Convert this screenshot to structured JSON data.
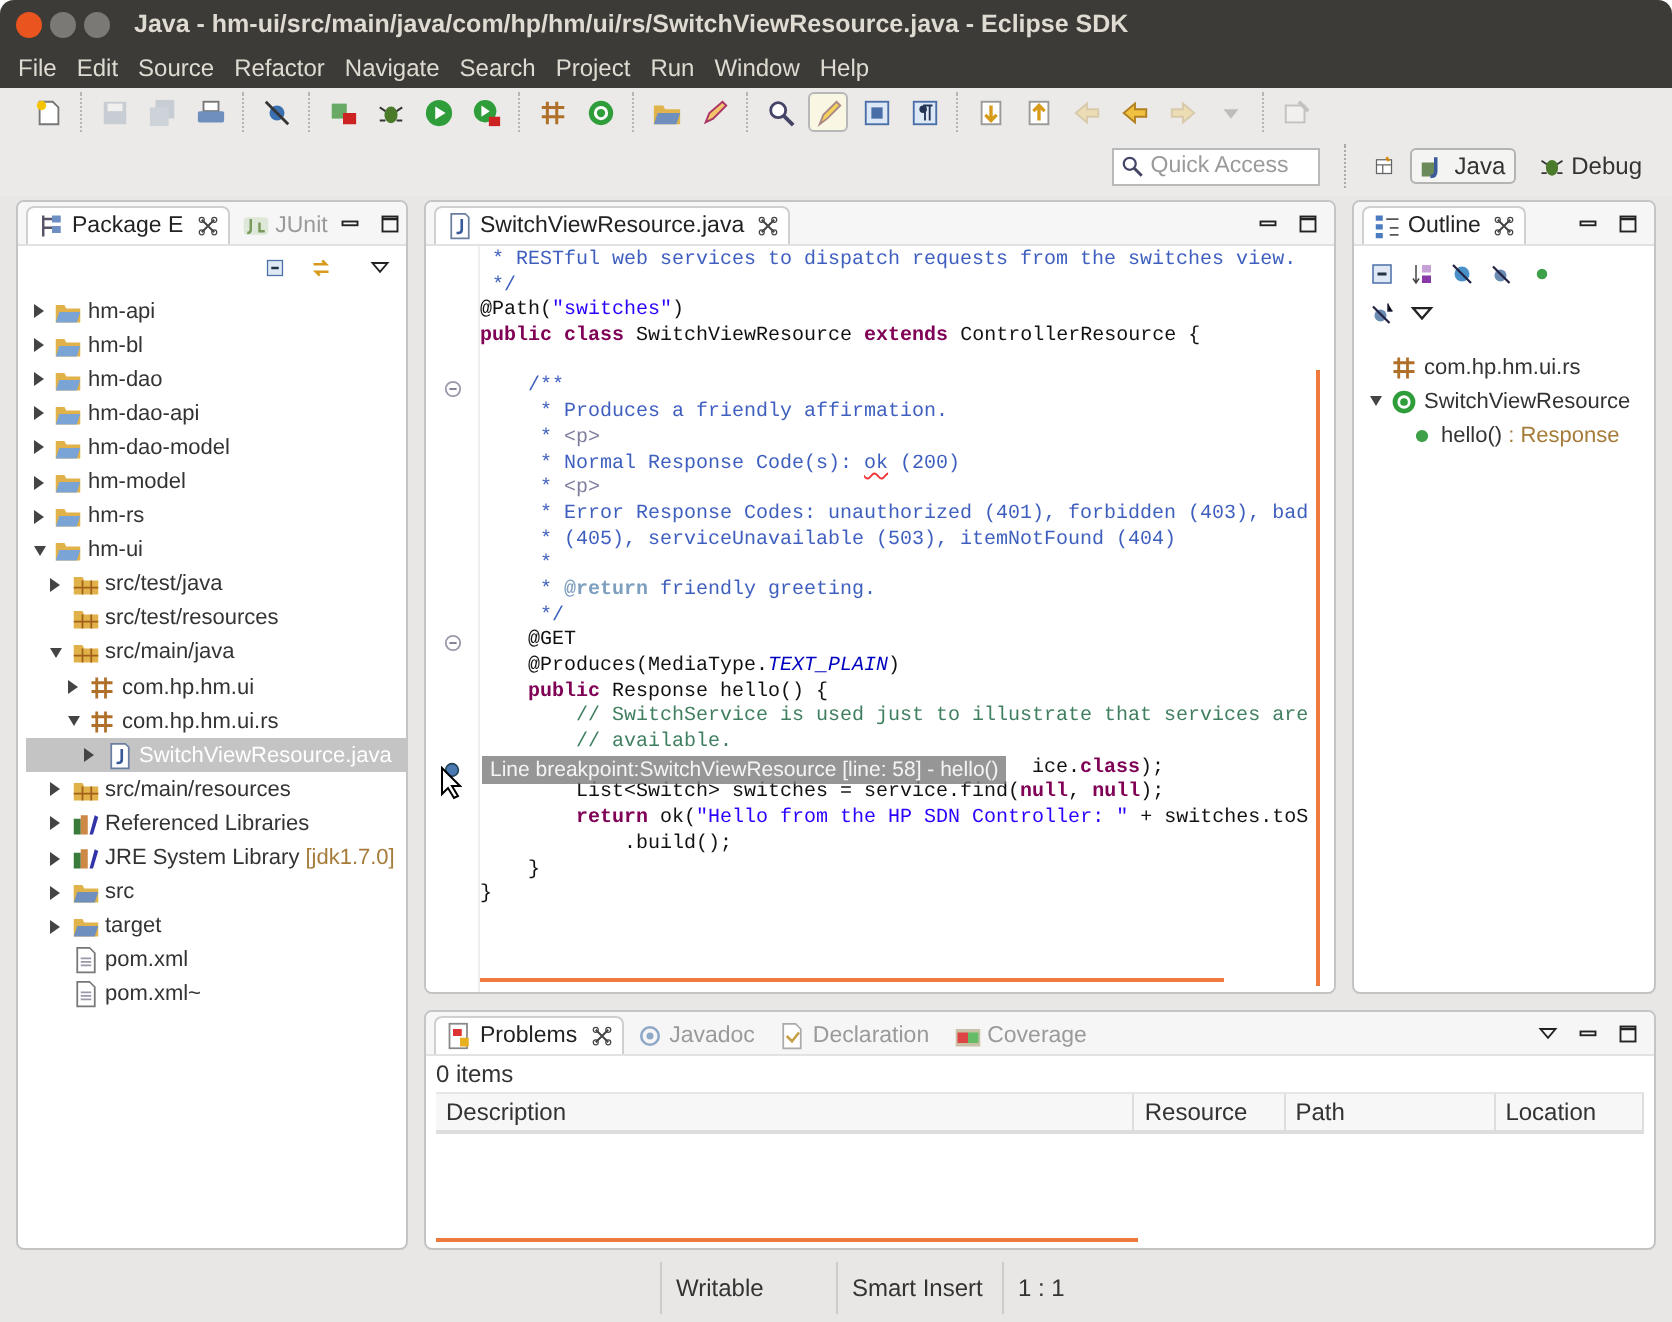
{
  "window": {
    "title": "Java - hm-ui/src/main/java/com/hp/hm/ui/rs/SwitchViewResource.java - Eclipse SDK"
  },
  "menu": [
    "File",
    "Edit",
    "Source",
    "Refactor",
    "Navigate",
    "Search",
    "Project",
    "Run",
    "Window",
    "Help"
  ],
  "toolbar": [
    [
      {
        "kind": "new-file",
        "disabled": false,
        "pressed": false
      }
    ],
    [
      {
        "kind": "save",
        "disabled": true,
        "pressed": false
      },
      {
        "kind": "save-all",
        "disabled": true,
        "pressed": false
      },
      {
        "kind": "print",
        "disabled": false,
        "pressed": false
      }
    ],
    [
      {
        "kind": "skip",
        "disabled": false,
        "pressed": false
      }
    ],
    [
      {
        "kind": "debug-config",
        "disabled": false,
        "pressed": false
      },
      {
        "kind": "bug",
        "disabled": false,
        "pressed": false
      },
      {
        "kind": "run",
        "disabled": false,
        "pressed": false
      },
      {
        "kind": "run-tool",
        "disabled": false,
        "pressed": false
      }
    ],
    [
      {
        "kind": "package",
        "disabled": false,
        "pressed": false
      },
      {
        "kind": "class",
        "disabled": false,
        "pressed": false
      }
    ],
    [
      {
        "kind": "folder",
        "disabled": false,
        "pressed": false
      },
      {
        "kind": "pencil",
        "disabled": false,
        "pressed": false
      }
    ],
    [
      {
        "kind": "search",
        "disabled": false,
        "pressed": false
      },
      {
        "kind": "marker",
        "disabled": false,
        "pressed": true
      },
      {
        "kind": "block",
        "disabled": false,
        "pressed": false
      },
      {
        "kind": "pilcrow",
        "disabled": false,
        "pressed": false
      }
    ],
    [
      {
        "kind": "arrow-down",
        "disabled": false,
        "pressed": false
      },
      {
        "kind": "arrow-up",
        "disabled": false,
        "pressed": false
      },
      {
        "kind": "back",
        "disabled": true,
        "pressed": false
      },
      {
        "kind": "back",
        "disabled": false,
        "pressed": false
      },
      {
        "kind": "forward",
        "disabled": true,
        "pressed": false
      },
      {
        "kind": "caret",
        "disabled": true,
        "pressed": false
      }
    ],
    [
      {
        "kind": "pin",
        "disabled": true,
        "pressed": false
      }
    ]
  ],
  "quick_access": {
    "placeholder": "Quick Access"
  },
  "perspectives": [
    {
      "kind": "java",
      "label": "Java",
      "selected": true
    },
    {
      "kind": "debug",
      "label": "Debug",
      "selected": false
    }
  ],
  "package_explorer": {
    "tabs": [
      {
        "kind": "package-explorer",
        "label": "Package E",
        "selected": true
      },
      {
        "kind": "junit",
        "label": "JUnit",
        "selected": false
      }
    ],
    "tree": [
      {
        "label": "hm-api",
        "kind": "project",
        "expanded": false,
        "selected": false
      },
      {
        "label": "hm-bl",
        "kind": "project",
        "expanded": false,
        "selected": false
      },
      {
        "label": "hm-dao",
        "kind": "project",
        "expanded": false,
        "selected": false
      },
      {
        "label": "hm-dao-api",
        "kind": "project",
        "expanded": false,
        "selected": false
      },
      {
        "label": "hm-dao-model",
        "kind": "project",
        "expanded": false,
        "selected": false
      },
      {
        "label": "hm-model",
        "kind": "project",
        "expanded": false,
        "selected": false
      },
      {
        "label": "hm-rs",
        "kind": "project",
        "expanded": false,
        "selected": false
      },
      {
        "label": "hm-ui",
        "kind": "project",
        "expanded": true,
        "selected": false,
        "children": [
          {
            "label": "src/test/java",
            "kind": "source-folder",
            "expanded": false,
            "selected": false
          },
          {
            "label": "src/test/resources",
            "kind": "source-folder",
            "selected": false
          },
          {
            "label": "src/main/java",
            "kind": "source-folder",
            "expanded": true,
            "selected": false,
            "children": [
              {
                "label": "com.hp.hm.ui",
                "kind": "package",
                "expanded": false,
                "selected": false
              },
              {
                "label": "com.hp.hm.ui.rs",
                "kind": "package",
                "expanded": true,
                "selected": false,
                "children": [
                  {
                    "label": "SwitchViewResource.java",
                    "kind": "java-file",
                    "expanded": false,
                    "selected": true
                  }
                ]
              }
            ]
          },
          {
            "label": "src/main/resources",
            "kind": "source-folder",
            "expanded": false,
            "selected": false
          },
          {
            "label": "Referenced Libraries",
            "kind": "library",
            "expanded": false,
            "selected": false
          },
          {
            "label": "JRE System Library",
            "decoration": "[jdk1.7.0]",
            "kind": "library",
            "expanded": false,
            "selected": false
          },
          {
            "label": "src",
            "kind": "folder",
            "expanded": false,
            "selected": false
          },
          {
            "label": "target",
            "kind": "folder",
            "expanded": false,
            "selected": false
          },
          {
            "label": "pom.xml",
            "kind": "file",
            "selected": false
          },
          {
            "label": "pom.xml~",
            "kind": "file",
            "selected": false
          }
        ]
      }
    ]
  },
  "editor": {
    "tabs": [
      {
        "kind": "java-file",
        "label": "SwitchViewResource.java",
        "selected": true
      }
    ],
    "lines": [
      {
        "kind": "code",
        "segments": [
          {
            "text": " * RESTful web services to dispatch requests from the switches view.",
            "kind": "doc"
          }
        ]
      },
      {
        "kind": "code",
        "segments": [
          {
            "text": " */",
            "kind": "doc"
          }
        ]
      },
      {
        "kind": "code",
        "segments": [
          {
            "text": "@Path(",
            "kind": "plain"
          },
          {
            "text": "\"switches\"",
            "kind": "str"
          },
          {
            "text": ")",
            "kind": "plain"
          }
        ]
      },
      {
        "kind": "code",
        "segments": [
          {
            "text": "public class",
            "kind": "kw"
          },
          {
            "text": " SwitchViewResource ",
            "kind": "plain"
          },
          {
            "text": "extends",
            "kind": "kw"
          },
          {
            "text": " ControllerResource {",
            "kind": "plain"
          }
        ]
      },
      {
        "kind": "blank"
      },
      {
        "kind": "fold",
        "segments": [
          {
            "text": "    /**",
            "kind": "doc"
          }
        ]
      },
      {
        "kind": "code",
        "segments": [
          {
            "text": "     * Produces a friendly affirmation.",
            "kind": "doc"
          }
        ]
      },
      {
        "kind": "code",
        "segments": [
          {
            "text": "     * ",
            "kind": "doc"
          },
          {
            "text": "<p>",
            "kind": "tag"
          }
        ]
      },
      {
        "kind": "code",
        "segments": [
          {
            "text": "     * Normal Response Code(s): ",
            "kind": "doc"
          },
          {
            "text": "ok",
            "kind": "spell"
          },
          {
            "text": " (200)",
            "kind": "doc"
          }
        ]
      },
      {
        "kind": "code",
        "segments": [
          {
            "text": "     * ",
            "kind": "doc"
          },
          {
            "text": "<p>",
            "kind": "tag"
          }
        ]
      },
      {
        "kind": "code",
        "segments": [
          {
            "text": "     * Error Response Codes: unauthorized (401), forbidden (403), bad",
            "kind": "doc"
          }
        ]
      },
      {
        "kind": "code",
        "segments": [
          {
            "text": "     * (405), serviceUnavailable (503), itemNotFound (404)",
            "kind": "doc"
          }
        ]
      },
      {
        "kind": "code",
        "segments": [
          {
            "text": "     *",
            "kind": "doc"
          }
        ]
      },
      {
        "kind": "code",
        "segments": [
          {
            "text": "     * ",
            "kind": "doc"
          },
          {
            "text": "@return",
            "kind": "doctag"
          },
          {
            "text": " friendly greeting.",
            "kind": "doc"
          }
        ]
      },
      {
        "kind": "code",
        "segments": [
          {
            "text": "     */",
            "kind": "doc"
          }
        ]
      },
      {
        "kind": "fold",
        "segments": [
          {
            "text": "    @GET",
            "kind": "plain"
          }
        ]
      },
      {
        "kind": "code",
        "segments": [
          {
            "text": "    @Produces(MediaType.",
            "kind": "plain"
          },
          {
            "text": "TEXT_PLAIN",
            "kind": "const"
          },
          {
            "text": ")",
            "kind": "plain"
          }
        ]
      },
      {
        "kind": "code",
        "segments": [
          {
            "text": "    public",
            "kind": "kw"
          },
          {
            "text": " Response hello() {",
            "kind": "plain"
          }
        ]
      },
      {
        "kind": "code",
        "segments": [
          {
            "text": "        // SwitchService is used just to illustrate that services are",
            "kind": "cmt"
          }
        ]
      },
      {
        "kind": "code",
        "segments": [
          {
            "text": "        // available.",
            "kind": "cmt"
          }
        ]
      },
      {
        "kind": "breakpoint",
        "segments": [
          {
            "text": "ice.",
            "kind": "plain"
          },
          {
            "text": "class",
            "kind": "kw"
          },
          {
            "text": ");",
            "kind": "plain"
          }
        ]
      },
      {
        "kind": "code",
        "segments": [
          {
            "text": "        List<Switch> switches = service.find(",
            "kind": "plain"
          },
          {
            "text": "null",
            "kind": "kw"
          },
          {
            "text": ", ",
            "kind": "plain"
          },
          {
            "text": "null",
            "kind": "kw"
          },
          {
            "text": ");",
            "kind": "plain"
          }
        ]
      },
      {
        "kind": "code",
        "segments": [
          {
            "text": "        return",
            "kind": "kw"
          },
          {
            "text": " ok(",
            "kind": "plain"
          },
          {
            "text": "\"Hello from the HP SDN Controller: \"",
            "kind": "str"
          },
          {
            "text": " + switches.toS",
            "kind": "plain"
          }
        ]
      },
      {
        "kind": "code",
        "segments": [
          {
            "text": "            .build();",
            "kind": "plain"
          }
        ]
      },
      {
        "kind": "code",
        "segments": [
          {
            "text": "    }",
            "kind": "plain"
          }
        ]
      },
      {
        "kind": "code",
        "segments": [
          {
            "text": "}",
            "kind": "plain"
          }
        ]
      }
    ],
    "tooltip": "Line breakpoint:SwitchViewResource [line: 58] - hello()"
  },
  "outline": {
    "tabs": [
      {
        "kind": "outline",
        "label": "Outline",
        "selected": true
      }
    ],
    "tree": [
      {
        "label": "com.hp.hm.ui.rs",
        "kind": "package",
        "selected": false
      },
      {
        "label": "SwitchViewResource",
        "kind": "class",
        "expanded": true,
        "selected": false,
        "children": [
          {
            "label": "hello()",
            "decoration": ": Response",
            "kind": "method",
            "selected": false
          }
        ]
      }
    ]
  },
  "problems": {
    "tabs": [
      {
        "kind": "problems",
        "label": "Problems",
        "selected": true
      },
      {
        "kind": "javadoc",
        "label": "Javadoc",
        "selected": false
      },
      {
        "kind": "declaration",
        "label": "Declaration",
        "selected": false
      },
      {
        "kind": "coverage",
        "label": "Coverage",
        "selected": false
      }
    ],
    "summary": "0 items",
    "columns": [
      "Description",
      "Resource",
      "Path",
      "Location"
    ]
  },
  "status_bar": [
    "Writable",
    "Smart Insert",
    "1 : 1"
  ]
}
